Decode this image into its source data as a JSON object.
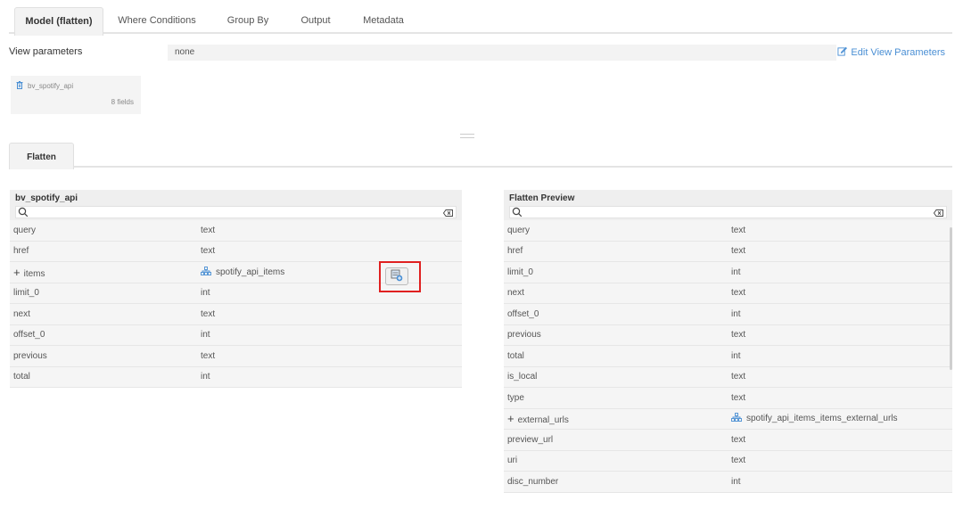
{
  "tabs": [
    {
      "label": "Model (flatten)",
      "active": true
    },
    {
      "label": "Where Conditions"
    },
    {
      "label": "Group By"
    },
    {
      "label": "Output"
    },
    {
      "label": "Metadata"
    }
  ],
  "view_params": {
    "label": "View parameters",
    "value": "none",
    "edit_label": "Edit View Parameters"
  },
  "source_card": {
    "name": "bv_spotify_api",
    "fields": "8 fields"
  },
  "section_tab": {
    "label": "Flatten"
  },
  "left_panel": {
    "title": "bv_spotify_api",
    "rows": [
      {
        "name": "query",
        "type": "text"
      },
      {
        "name": "href",
        "type": "text"
      },
      {
        "name": "items",
        "type": "spotify_api_items",
        "expandable": true
      },
      {
        "name": "limit_0",
        "type": "int"
      },
      {
        "name": "next",
        "type": "text"
      },
      {
        "name": "offset_0",
        "type": "int"
      },
      {
        "name": "previous",
        "type": "text"
      },
      {
        "name": "total",
        "type": "int"
      }
    ]
  },
  "right_panel": {
    "title": "Flatten Preview",
    "rows": [
      {
        "name": "query",
        "type": "text"
      },
      {
        "name": "href",
        "type": "text"
      },
      {
        "name": "limit_0",
        "type": "int"
      },
      {
        "name": "next",
        "type": "text"
      },
      {
        "name": "offset_0",
        "type": "int"
      },
      {
        "name": "previous",
        "type": "text"
      },
      {
        "name": "total",
        "type": "int"
      },
      {
        "name": "is_local",
        "type": "text"
      },
      {
        "name": "type",
        "type": "text"
      },
      {
        "name": "external_urls",
        "type": "spotify_api_items_items_external_urls",
        "expandable": true
      },
      {
        "name": "preview_url",
        "type": "text"
      },
      {
        "name": "uri",
        "type": "text"
      },
      {
        "name": "disc_number",
        "type": "int"
      }
    ]
  },
  "colors": {
    "accent": "#4a8fd4",
    "highlight": "#e02020"
  }
}
